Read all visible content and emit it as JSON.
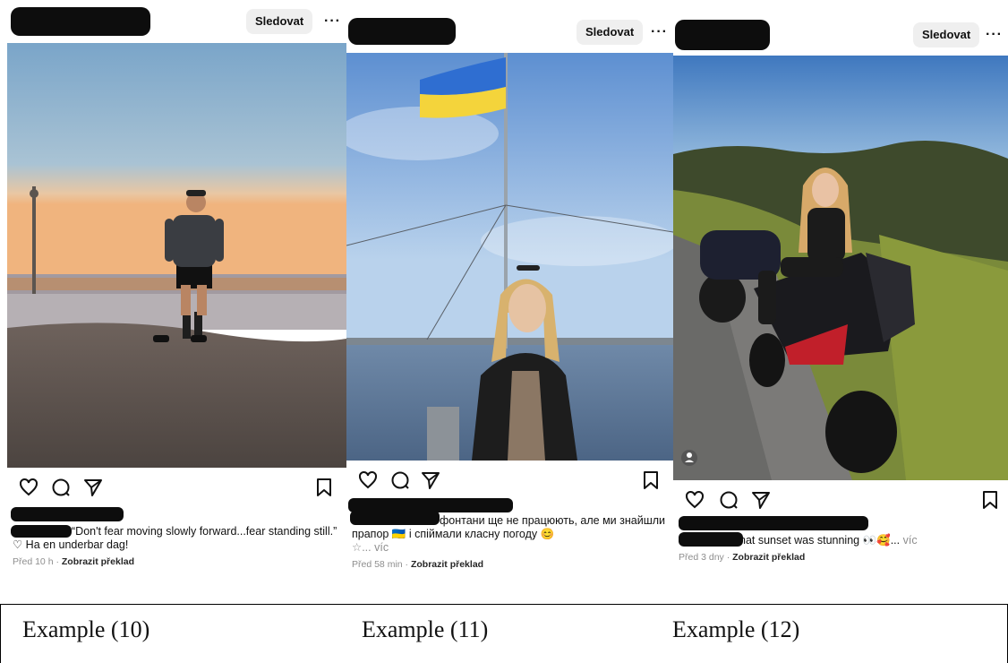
{
  "posts": [
    {
      "follow_label": "Sledovat",
      "more_label": "···",
      "caption_text": "“Don't fear moving slowly forward...fear standing still.” ♡ Ha en underbar dag!",
      "time": "Před 10 h",
      "separator": " · ",
      "translate_label": "Zobrazit překlad"
    },
    {
      "follow_label": "Sledovat",
      "more_label": "···",
      "caption_text": "фонтани ще не працюють, але ми знайшли прапор 🇺🇦 і спіймали класну погоду 😊",
      "caption_line2": "☆... víc",
      "time": "Před 58 min",
      "separator": " · ",
      "translate_label": "Zobrazit překlad"
    },
    {
      "follow_label": "Sledovat",
      "more_label": "···",
      "caption_text": "hat sunset was stunning 👀🥰...",
      "more_link": " víc",
      "time": "Před 3 dny",
      "separator": " · ",
      "translate_label": "Zobrazit překlad"
    }
  ],
  "labels": [
    "Example (10)",
    "Example (11)",
    "Example (12)"
  ],
  "colors": {
    "follow_bg": "#efefef",
    "redaction": "#0d0d0d",
    "meta_gray": "#8e8e8e"
  }
}
